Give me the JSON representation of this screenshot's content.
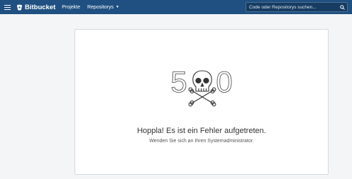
{
  "header": {
    "brand": "Bitbucket",
    "nav": [
      {
        "label": "Projekte"
      },
      {
        "label": "Repositorys",
        "has_dropdown": true
      }
    ],
    "search": {
      "placeholder": "Code oder Repositorys suchen...",
      "value": ""
    },
    "icons": {
      "menu": "hamburger-icon",
      "brand": "bitbucket-logo-icon",
      "search": "search-icon"
    },
    "colors": {
      "bar": "#205081"
    }
  },
  "error": {
    "code_left": "5",
    "code_right": "0",
    "title": "Hoppla! Es ist ein Fehler aufgetreten.",
    "subtitle": "Wenden Sie sich an Ihren Systemadministrator.",
    "illustration": "skull-crossbones-500"
  }
}
